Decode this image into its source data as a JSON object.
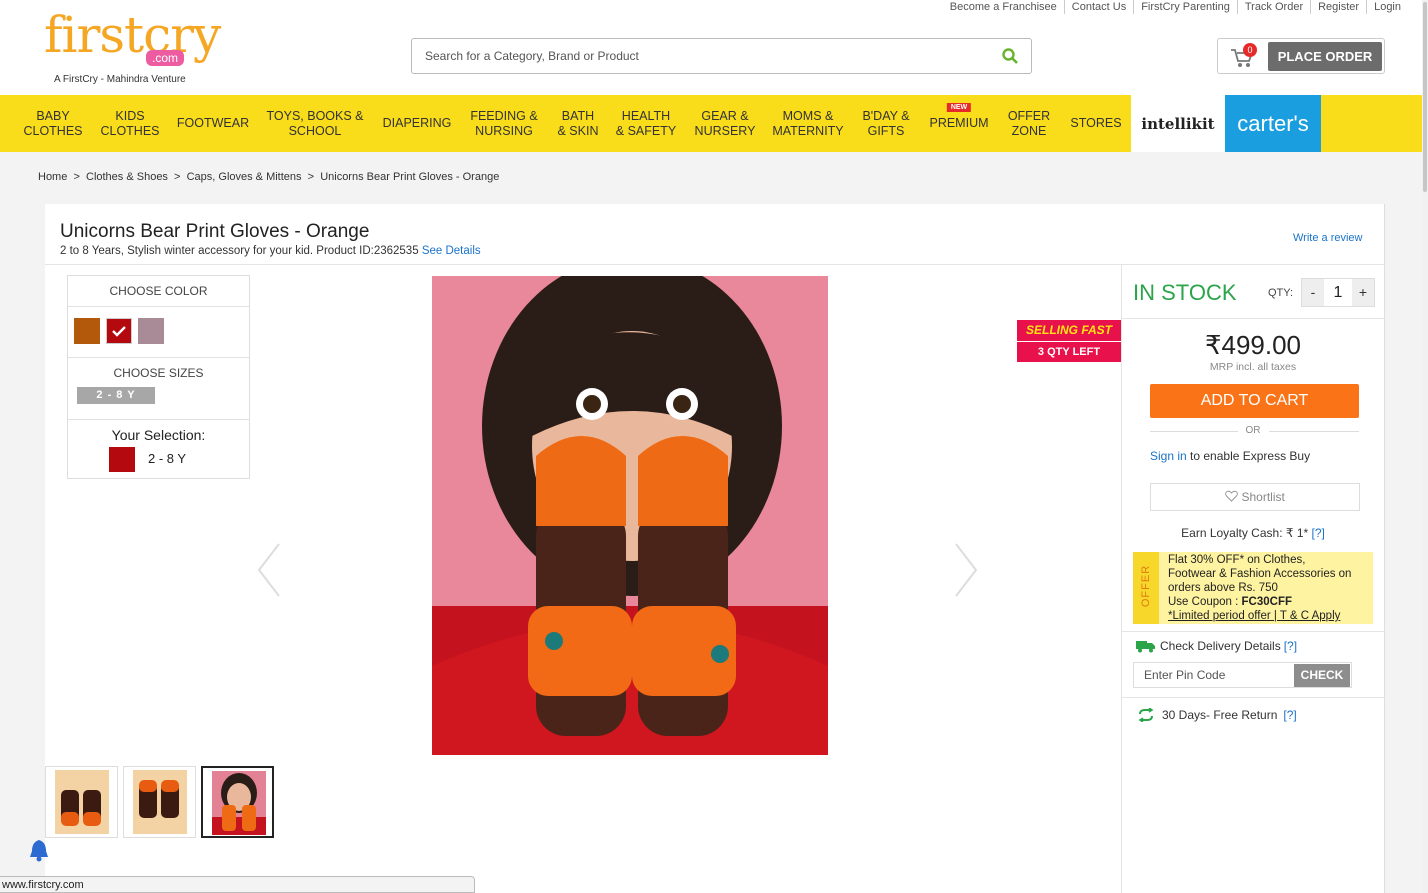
{
  "logo": {
    "word": "firstcry",
    "dotcom": ".com",
    "tagline": "A FirstCry - Mahindra Venture"
  },
  "top_links": [
    "Become a Franchisee",
    "Contact Us",
    "FirstCry Parenting",
    "Track Order",
    "Register",
    "Login"
  ],
  "search": {
    "placeholder": "Search for a Category, Brand or Product"
  },
  "cart": {
    "count": "0",
    "place_order": "PLACE ORDER"
  },
  "nav": [
    {
      "label": "BABY\nCLOTHES"
    },
    {
      "label": "KIDS\nCLOTHES"
    },
    {
      "label": "FOOTWEAR"
    },
    {
      "label": "TOYS, BOOKS &\nSCHOOL"
    },
    {
      "label": "DIAPERING"
    },
    {
      "label": "FEEDING &\nNURSING"
    },
    {
      "label": "BATH\n& SKIN"
    },
    {
      "label": "HEALTH\n& SAFETY"
    },
    {
      "label": "GEAR &\nNURSERY"
    },
    {
      "label": "MOMS &\nMATERNITY"
    },
    {
      "label": "B'DAY &\nGIFTS"
    },
    {
      "label": "PREMIUM",
      "badge": "NEW"
    },
    {
      "label": "OFFER\nZONE"
    },
    {
      "label": "STORES"
    }
  ],
  "brands": {
    "intellikit": "intellikit",
    "carters": "carter's"
  },
  "breadcrumb": [
    "Home",
    "Clothes & Shoes",
    "Caps, Gloves & Mittens",
    "Unicorns Bear Print Gloves - Orange"
  ],
  "product": {
    "title": "Unicorns Bear Print Gloves - Orange",
    "subtitle": "2 to 8 Years, Stylish winter accessory for your kid. Product ID:2362535",
    "see_details": "See Details",
    "write_review": "Write a review"
  },
  "options": {
    "choose_color": "CHOOSE COLOR",
    "colors": [
      "#b3590c",
      "#b3090f",
      "#a88b97"
    ],
    "selected_color_index": 1,
    "choose_sizes": "CHOOSE SIZES",
    "size": "2 - 8 Y",
    "your_selection": "Your Selection:",
    "selection_size": "2 - 8 Y"
  },
  "badges": {
    "selling_fast": "SELLING FAST",
    "qty_left": "3 QTY LEFT"
  },
  "buy": {
    "stock": "IN STOCK",
    "qty_label": "QTY:",
    "qty": "1",
    "minus": "-",
    "plus": "+",
    "price": "₹499.00",
    "mrp_note": "MRP incl. all taxes",
    "add_to_cart": "ADD TO CART",
    "or": "OR",
    "sign_in": "Sign in",
    "sign_in_rest": " to enable Express Buy",
    "shortlist": "Shortlist",
    "loyalty": "Earn Loyalty Cash: ₹ 1*",
    "help": "[?]"
  },
  "offer": {
    "tab": "OFFER",
    "line1": "Flat 30% OFF* on Clothes,",
    "line2": "Footwear & Fashion Accessories on",
    "line3": "orders above Rs. 750",
    "coupon_label": "Use Coupon : ",
    "coupon": "FC30CFF",
    "terms": "*Limited period offer | T & C Apply"
  },
  "delivery": {
    "label": "Check Delivery Details",
    "pin_placeholder": "Enter Pin Code",
    "check": "CHECK"
  },
  "returns": {
    "label": "30 Days- Free Return"
  },
  "status_bar": "www.firstcry.com"
}
